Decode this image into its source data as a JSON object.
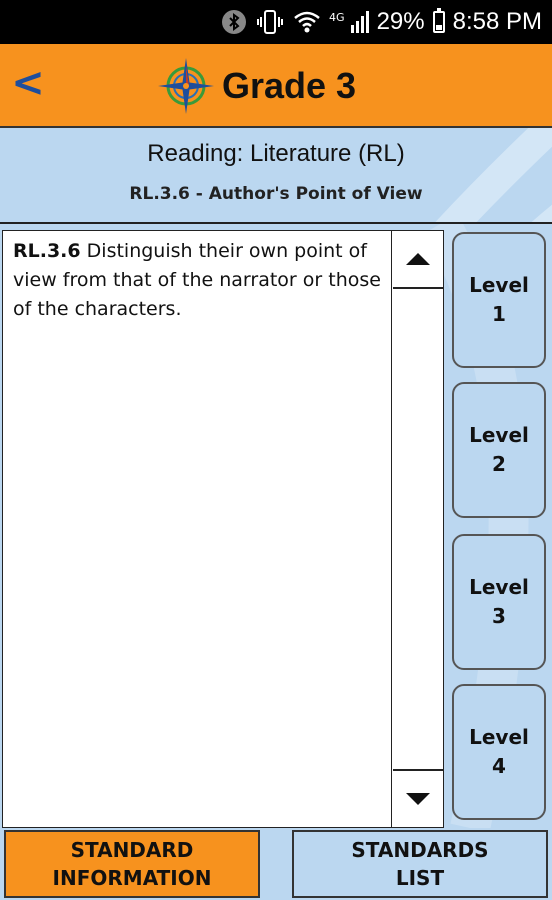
{
  "status_bar": {
    "icons": [
      "bluetooth-icon",
      "vibrate-icon",
      "wifi-icon",
      "4g-lte-icon",
      "signal-icon",
      "battery-icon"
    ],
    "network_label": "4G",
    "battery_percent": "29%",
    "time": "8:58 PM"
  },
  "header": {
    "back_label": "<",
    "title": "Grade 3",
    "logo": "compass-logo",
    "color": "#F7921E"
  },
  "subheader": {
    "subject": "Reading: Literature (RL)",
    "standard": "RL.3.6 - Author's Point of View"
  },
  "standard": {
    "code": "RL.3.6",
    "text": " Distinguish their own point of view from that of the narrator or those of the characters."
  },
  "levels": [
    {
      "label": "Level\n1"
    },
    {
      "label": "Level\n2"
    },
    {
      "label": "Level\n3"
    },
    {
      "label": "Level\n4"
    }
  ],
  "bottom": {
    "info_label": "STANDARD\nINFORMATION",
    "list_label": "STANDARDS\nLIST"
  },
  "colors": {
    "accent": "#F7921E",
    "panel": "#BBD7F0",
    "back_arrow": "#1F4E9C"
  }
}
